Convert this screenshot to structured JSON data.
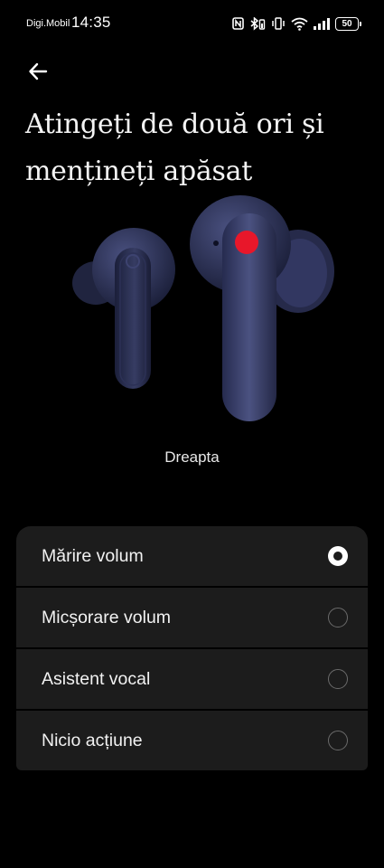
{
  "status_bar": {
    "carrier": "Digi.Mobil",
    "time": "14:35",
    "icons": [
      "nfc-icon",
      "bluetooth-battery-icon",
      "vibrate-icon",
      "wifi-icon",
      "signal-icon"
    ],
    "battery": "50"
  },
  "header": {
    "back_icon": "arrow-left-icon",
    "title": "Atingeți de două ori și mențineți apăsat"
  },
  "illustration": {
    "highlight_color": "#e8172a",
    "side_label": "Dreapta"
  },
  "options": [
    {
      "label": "Mărire volum",
      "selected": true
    },
    {
      "label": "Micșorare volum",
      "selected": false
    },
    {
      "label": "Asistent vocal",
      "selected": false
    },
    {
      "label": "Nicio acțiune",
      "selected": false
    }
  ]
}
